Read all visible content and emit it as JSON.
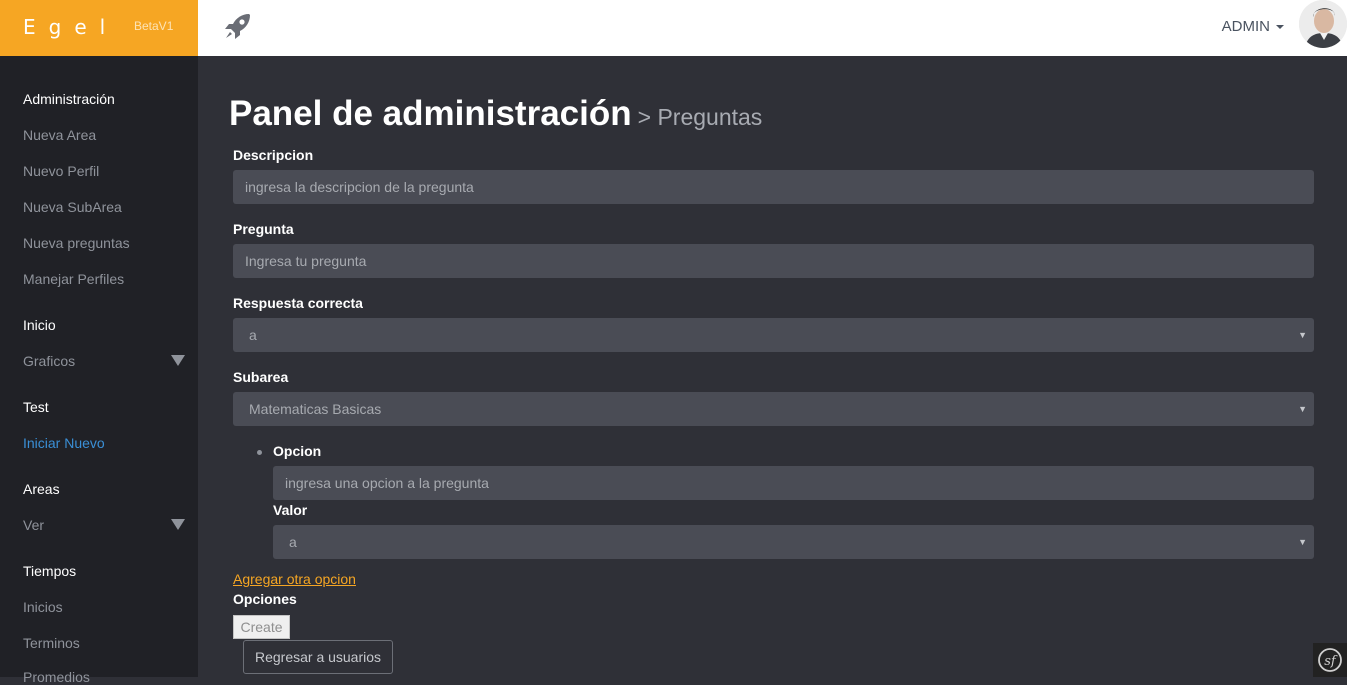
{
  "header": {
    "brand": "Egel",
    "version": "BetaV1",
    "user": "ADMIN"
  },
  "sidebar": {
    "sections": [
      {
        "label": "Administración",
        "items": [
          "Nueva Area",
          "Nuevo Perfil",
          "Nueva SubArea",
          "Nueva preguntas",
          "Manejar Perfiles"
        ]
      },
      {
        "label": "Inicio",
        "items": [
          "Graficos"
        ]
      },
      {
        "label": "Test",
        "items": [
          "Iniciar Nuevo"
        ]
      },
      {
        "label": "Areas",
        "items": [
          "Ver"
        ]
      },
      {
        "label": "Tiempos",
        "items": [
          "Inicios",
          "Terminos",
          "Promedios"
        ]
      }
    ],
    "active_item": "Iniciar Nuevo"
  },
  "page": {
    "title": "Panel de administración",
    "subtitle": "> Preguntas"
  },
  "form": {
    "descripcion": {
      "label": "Descripcion",
      "placeholder": "ingresa la descripcion de la pregunta"
    },
    "pregunta": {
      "label": "Pregunta",
      "placeholder": "Ingresa tu pregunta"
    },
    "respuesta": {
      "label": "Respuesta correcta",
      "value": "a"
    },
    "subarea": {
      "label": "Subarea",
      "value": "Matematicas Basicas"
    },
    "opcion": {
      "label": "Opcion",
      "placeholder": "ingresa una opcion a la pregunta"
    },
    "valor": {
      "label": "Valor",
      "value": "a"
    },
    "add_option_link": "Agregar otra opcion",
    "opciones_label": "Opciones",
    "create_button": "Create",
    "back_button": "Regresar a usuarios"
  },
  "colors": {
    "brand": "#f6a623",
    "link_active": "#3a8fd6"
  },
  "icons": [
    "rocket-icon",
    "caret-down-icon",
    "avatar",
    "triangle-down-icon",
    "symfony-icon"
  ]
}
